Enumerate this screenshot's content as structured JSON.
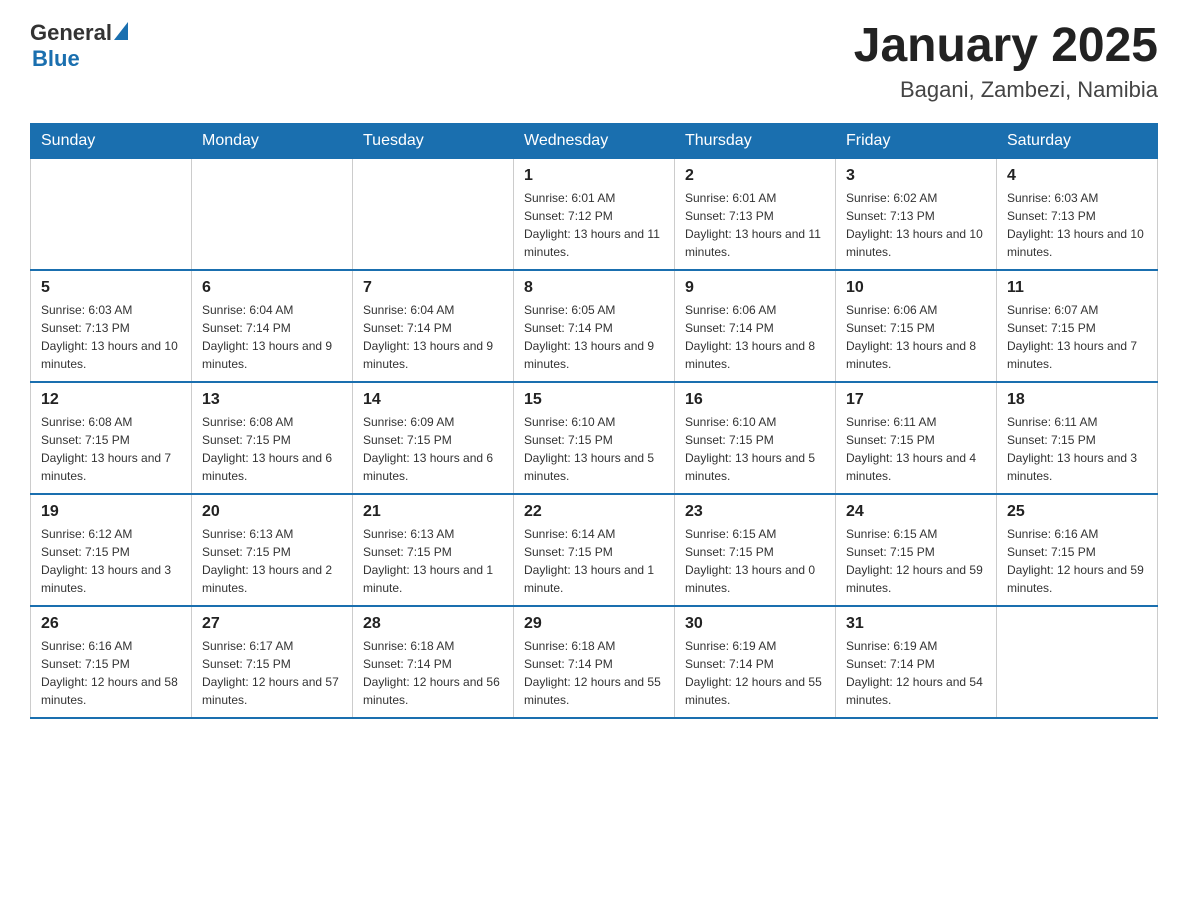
{
  "header": {
    "logo_general": "General",
    "logo_blue": "Blue",
    "month_title": "January 2025",
    "location": "Bagani, Zambezi, Namibia"
  },
  "days_of_week": [
    "Sunday",
    "Monday",
    "Tuesday",
    "Wednesday",
    "Thursday",
    "Friday",
    "Saturday"
  ],
  "weeks": [
    [
      {
        "day": "",
        "info": ""
      },
      {
        "day": "",
        "info": ""
      },
      {
        "day": "",
        "info": ""
      },
      {
        "day": "1",
        "info": "Sunrise: 6:01 AM\nSunset: 7:12 PM\nDaylight: 13 hours and 11 minutes."
      },
      {
        "day": "2",
        "info": "Sunrise: 6:01 AM\nSunset: 7:13 PM\nDaylight: 13 hours and 11 minutes."
      },
      {
        "day": "3",
        "info": "Sunrise: 6:02 AM\nSunset: 7:13 PM\nDaylight: 13 hours and 10 minutes."
      },
      {
        "day": "4",
        "info": "Sunrise: 6:03 AM\nSunset: 7:13 PM\nDaylight: 13 hours and 10 minutes."
      }
    ],
    [
      {
        "day": "5",
        "info": "Sunrise: 6:03 AM\nSunset: 7:13 PM\nDaylight: 13 hours and 10 minutes."
      },
      {
        "day": "6",
        "info": "Sunrise: 6:04 AM\nSunset: 7:14 PM\nDaylight: 13 hours and 9 minutes."
      },
      {
        "day": "7",
        "info": "Sunrise: 6:04 AM\nSunset: 7:14 PM\nDaylight: 13 hours and 9 minutes."
      },
      {
        "day": "8",
        "info": "Sunrise: 6:05 AM\nSunset: 7:14 PM\nDaylight: 13 hours and 9 minutes."
      },
      {
        "day": "9",
        "info": "Sunrise: 6:06 AM\nSunset: 7:14 PM\nDaylight: 13 hours and 8 minutes."
      },
      {
        "day": "10",
        "info": "Sunrise: 6:06 AM\nSunset: 7:15 PM\nDaylight: 13 hours and 8 minutes."
      },
      {
        "day": "11",
        "info": "Sunrise: 6:07 AM\nSunset: 7:15 PM\nDaylight: 13 hours and 7 minutes."
      }
    ],
    [
      {
        "day": "12",
        "info": "Sunrise: 6:08 AM\nSunset: 7:15 PM\nDaylight: 13 hours and 7 minutes."
      },
      {
        "day": "13",
        "info": "Sunrise: 6:08 AM\nSunset: 7:15 PM\nDaylight: 13 hours and 6 minutes."
      },
      {
        "day": "14",
        "info": "Sunrise: 6:09 AM\nSunset: 7:15 PM\nDaylight: 13 hours and 6 minutes."
      },
      {
        "day": "15",
        "info": "Sunrise: 6:10 AM\nSunset: 7:15 PM\nDaylight: 13 hours and 5 minutes."
      },
      {
        "day": "16",
        "info": "Sunrise: 6:10 AM\nSunset: 7:15 PM\nDaylight: 13 hours and 5 minutes."
      },
      {
        "day": "17",
        "info": "Sunrise: 6:11 AM\nSunset: 7:15 PM\nDaylight: 13 hours and 4 minutes."
      },
      {
        "day": "18",
        "info": "Sunrise: 6:11 AM\nSunset: 7:15 PM\nDaylight: 13 hours and 3 minutes."
      }
    ],
    [
      {
        "day": "19",
        "info": "Sunrise: 6:12 AM\nSunset: 7:15 PM\nDaylight: 13 hours and 3 minutes."
      },
      {
        "day": "20",
        "info": "Sunrise: 6:13 AM\nSunset: 7:15 PM\nDaylight: 13 hours and 2 minutes."
      },
      {
        "day": "21",
        "info": "Sunrise: 6:13 AM\nSunset: 7:15 PM\nDaylight: 13 hours and 1 minute."
      },
      {
        "day": "22",
        "info": "Sunrise: 6:14 AM\nSunset: 7:15 PM\nDaylight: 13 hours and 1 minute."
      },
      {
        "day": "23",
        "info": "Sunrise: 6:15 AM\nSunset: 7:15 PM\nDaylight: 13 hours and 0 minutes."
      },
      {
        "day": "24",
        "info": "Sunrise: 6:15 AM\nSunset: 7:15 PM\nDaylight: 12 hours and 59 minutes."
      },
      {
        "day": "25",
        "info": "Sunrise: 6:16 AM\nSunset: 7:15 PM\nDaylight: 12 hours and 59 minutes."
      }
    ],
    [
      {
        "day": "26",
        "info": "Sunrise: 6:16 AM\nSunset: 7:15 PM\nDaylight: 12 hours and 58 minutes."
      },
      {
        "day": "27",
        "info": "Sunrise: 6:17 AM\nSunset: 7:15 PM\nDaylight: 12 hours and 57 minutes."
      },
      {
        "day": "28",
        "info": "Sunrise: 6:18 AM\nSunset: 7:14 PM\nDaylight: 12 hours and 56 minutes."
      },
      {
        "day": "29",
        "info": "Sunrise: 6:18 AM\nSunset: 7:14 PM\nDaylight: 12 hours and 55 minutes."
      },
      {
        "day": "30",
        "info": "Sunrise: 6:19 AM\nSunset: 7:14 PM\nDaylight: 12 hours and 55 minutes."
      },
      {
        "day": "31",
        "info": "Sunrise: 6:19 AM\nSunset: 7:14 PM\nDaylight: 12 hours and 54 minutes."
      },
      {
        "day": "",
        "info": ""
      }
    ]
  ]
}
